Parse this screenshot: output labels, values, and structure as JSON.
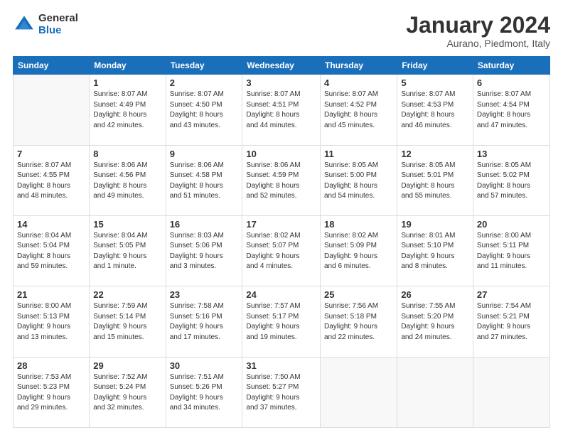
{
  "logo": {
    "general": "General",
    "blue": "Blue"
  },
  "title": "January 2024",
  "location": "Aurano, Piedmont, Italy",
  "headers": [
    "Sunday",
    "Monday",
    "Tuesday",
    "Wednesday",
    "Thursday",
    "Friday",
    "Saturday"
  ],
  "weeks": [
    [
      {
        "day": "",
        "content": ""
      },
      {
        "day": "1",
        "content": "Sunrise: 8:07 AM\nSunset: 4:49 PM\nDaylight: 8 hours\nand 42 minutes."
      },
      {
        "day": "2",
        "content": "Sunrise: 8:07 AM\nSunset: 4:50 PM\nDaylight: 8 hours\nand 43 minutes."
      },
      {
        "day": "3",
        "content": "Sunrise: 8:07 AM\nSunset: 4:51 PM\nDaylight: 8 hours\nand 44 minutes."
      },
      {
        "day": "4",
        "content": "Sunrise: 8:07 AM\nSunset: 4:52 PM\nDaylight: 8 hours\nand 45 minutes."
      },
      {
        "day": "5",
        "content": "Sunrise: 8:07 AM\nSunset: 4:53 PM\nDaylight: 8 hours\nand 46 minutes."
      },
      {
        "day": "6",
        "content": "Sunrise: 8:07 AM\nSunset: 4:54 PM\nDaylight: 8 hours\nand 47 minutes."
      }
    ],
    [
      {
        "day": "7",
        "content": "Sunrise: 8:07 AM\nSunset: 4:55 PM\nDaylight: 8 hours\nand 48 minutes."
      },
      {
        "day": "8",
        "content": "Sunrise: 8:06 AM\nSunset: 4:56 PM\nDaylight: 8 hours\nand 49 minutes."
      },
      {
        "day": "9",
        "content": "Sunrise: 8:06 AM\nSunset: 4:58 PM\nDaylight: 8 hours\nand 51 minutes."
      },
      {
        "day": "10",
        "content": "Sunrise: 8:06 AM\nSunset: 4:59 PM\nDaylight: 8 hours\nand 52 minutes."
      },
      {
        "day": "11",
        "content": "Sunrise: 8:05 AM\nSunset: 5:00 PM\nDaylight: 8 hours\nand 54 minutes."
      },
      {
        "day": "12",
        "content": "Sunrise: 8:05 AM\nSunset: 5:01 PM\nDaylight: 8 hours\nand 55 minutes."
      },
      {
        "day": "13",
        "content": "Sunrise: 8:05 AM\nSunset: 5:02 PM\nDaylight: 8 hours\nand 57 minutes."
      }
    ],
    [
      {
        "day": "14",
        "content": "Sunrise: 8:04 AM\nSunset: 5:04 PM\nDaylight: 8 hours\nand 59 minutes."
      },
      {
        "day": "15",
        "content": "Sunrise: 8:04 AM\nSunset: 5:05 PM\nDaylight: 9 hours\nand 1 minute."
      },
      {
        "day": "16",
        "content": "Sunrise: 8:03 AM\nSunset: 5:06 PM\nDaylight: 9 hours\nand 3 minutes."
      },
      {
        "day": "17",
        "content": "Sunrise: 8:02 AM\nSunset: 5:07 PM\nDaylight: 9 hours\nand 4 minutes."
      },
      {
        "day": "18",
        "content": "Sunrise: 8:02 AM\nSunset: 5:09 PM\nDaylight: 9 hours\nand 6 minutes."
      },
      {
        "day": "19",
        "content": "Sunrise: 8:01 AM\nSunset: 5:10 PM\nDaylight: 9 hours\nand 8 minutes."
      },
      {
        "day": "20",
        "content": "Sunrise: 8:00 AM\nSunset: 5:11 PM\nDaylight: 9 hours\nand 11 minutes."
      }
    ],
    [
      {
        "day": "21",
        "content": "Sunrise: 8:00 AM\nSunset: 5:13 PM\nDaylight: 9 hours\nand 13 minutes."
      },
      {
        "day": "22",
        "content": "Sunrise: 7:59 AM\nSunset: 5:14 PM\nDaylight: 9 hours\nand 15 minutes."
      },
      {
        "day": "23",
        "content": "Sunrise: 7:58 AM\nSunset: 5:16 PM\nDaylight: 9 hours\nand 17 minutes."
      },
      {
        "day": "24",
        "content": "Sunrise: 7:57 AM\nSunset: 5:17 PM\nDaylight: 9 hours\nand 19 minutes."
      },
      {
        "day": "25",
        "content": "Sunrise: 7:56 AM\nSunset: 5:18 PM\nDaylight: 9 hours\nand 22 minutes."
      },
      {
        "day": "26",
        "content": "Sunrise: 7:55 AM\nSunset: 5:20 PM\nDaylight: 9 hours\nand 24 minutes."
      },
      {
        "day": "27",
        "content": "Sunrise: 7:54 AM\nSunset: 5:21 PM\nDaylight: 9 hours\nand 27 minutes."
      }
    ],
    [
      {
        "day": "28",
        "content": "Sunrise: 7:53 AM\nSunset: 5:23 PM\nDaylight: 9 hours\nand 29 minutes."
      },
      {
        "day": "29",
        "content": "Sunrise: 7:52 AM\nSunset: 5:24 PM\nDaylight: 9 hours\nand 32 minutes."
      },
      {
        "day": "30",
        "content": "Sunrise: 7:51 AM\nSunset: 5:26 PM\nDaylight: 9 hours\nand 34 minutes."
      },
      {
        "day": "31",
        "content": "Sunrise: 7:50 AM\nSunset: 5:27 PM\nDaylight: 9 hours\nand 37 minutes."
      },
      {
        "day": "",
        "content": ""
      },
      {
        "day": "",
        "content": ""
      },
      {
        "day": "",
        "content": ""
      }
    ]
  ]
}
